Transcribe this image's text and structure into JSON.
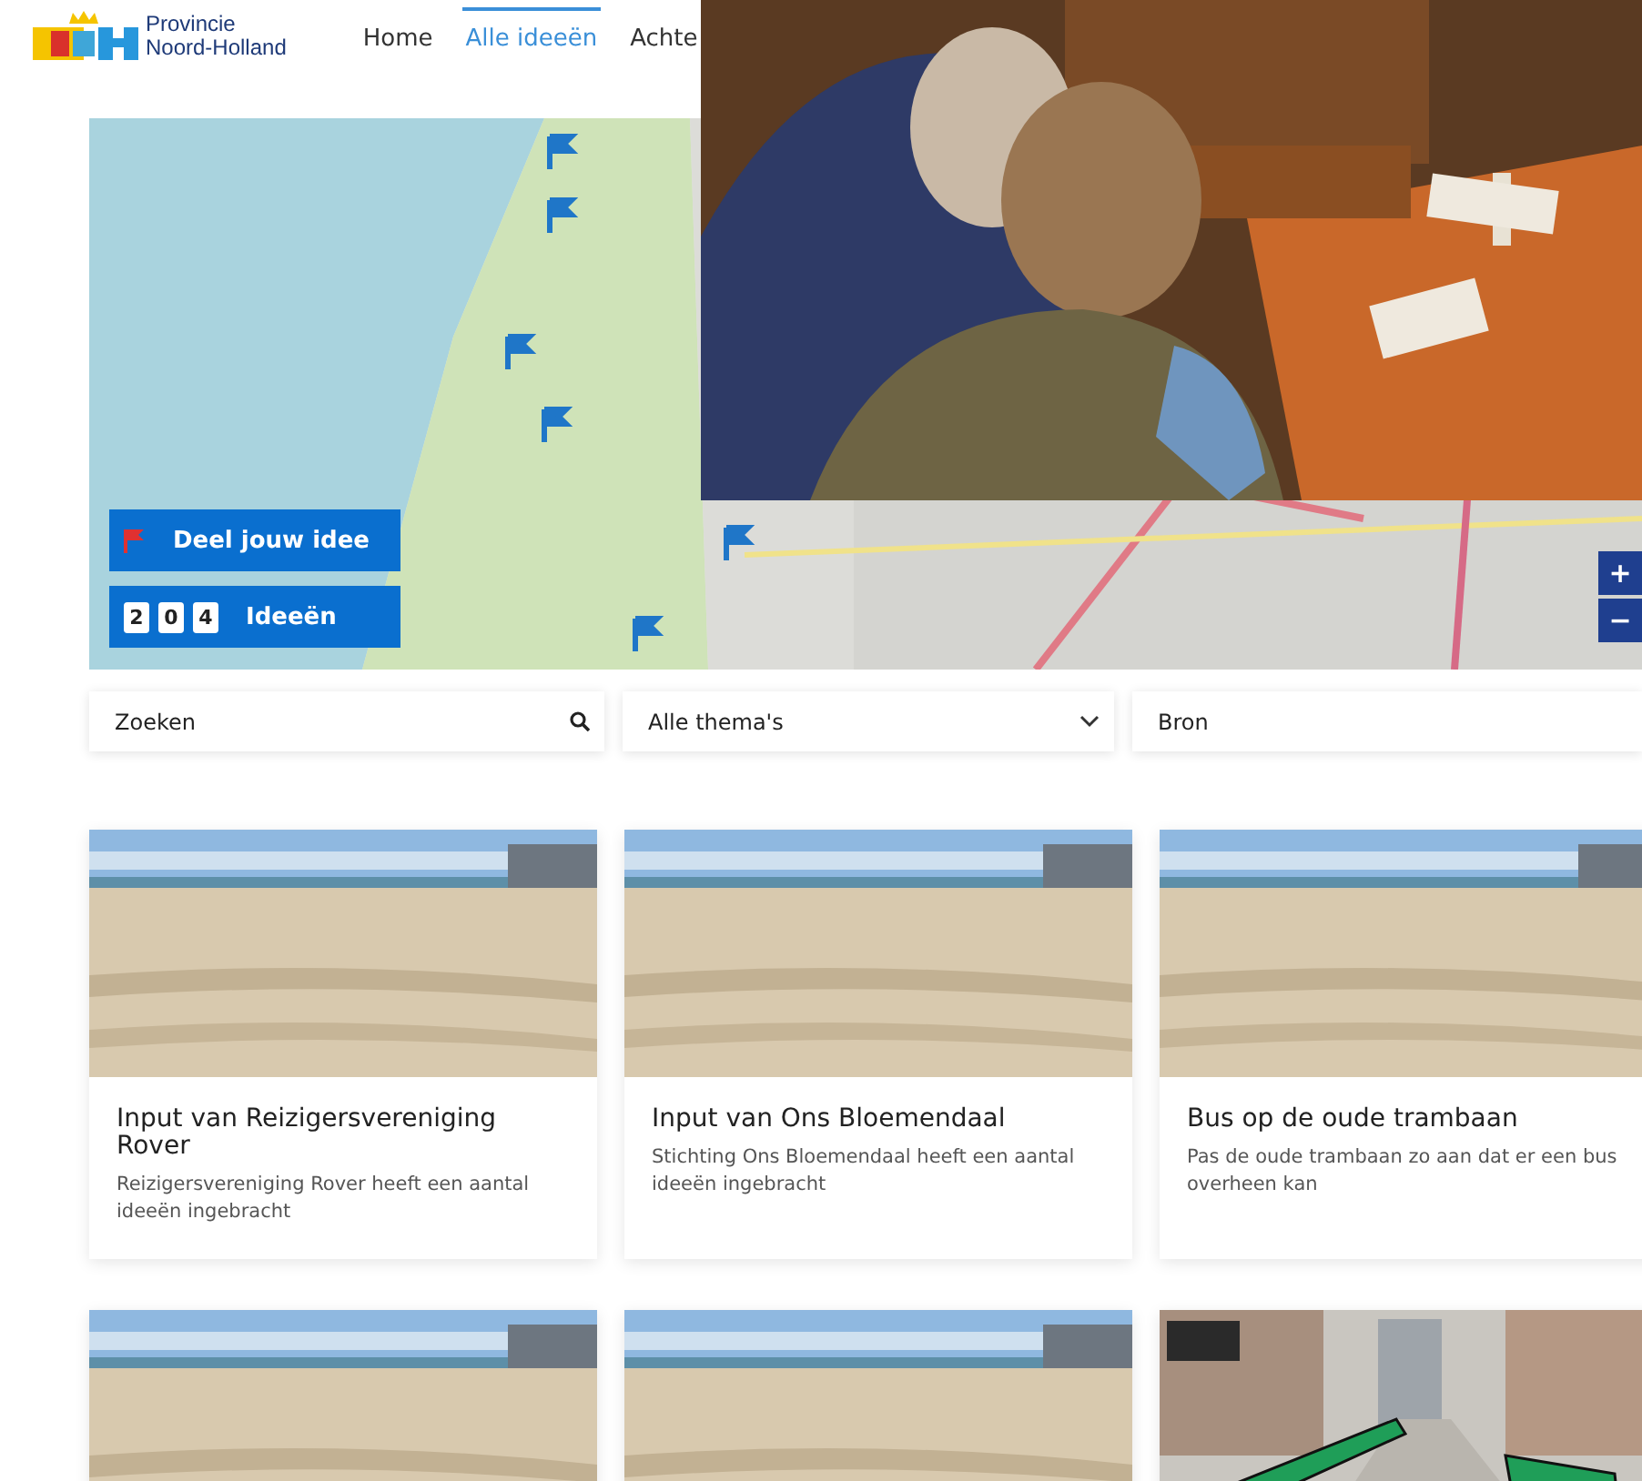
{
  "header": {
    "logo": {
      "line1": "Provincie",
      "line2": "Noord-Holland"
    },
    "nav": [
      {
        "label": "Home",
        "selected": false
      },
      {
        "label": "Alle ideeën",
        "selected": true
      },
      {
        "label": "Achte",
        "selected": false
      }
    ]
  },
  "map": {
    "share_button": "Deel jouw idee",
    "count_digits": [
      "2",
      "0",
      "4"
    ],
    "count_label": "Ideeën",
    "zoom_in": "+",
    "zoom_out": "−"
  },
  "filters": {
    "search": {
      "placeholder": "Zoeken"
    },
    "theme": "Alle thema's",
    "source": "Bron"
  },
  "cards": [
    {
      "kind": "card",
      "title": "Input van Reizigersvereniging Rover",
      "text": "Reizigersvereniging Rover heeft een aantal ideeën ingebracht"
    },
    {
      "kind": "card",
      "title": "Input van Ons Bloemendaal",
      "text": "Stichting Ons Bloemendaal heeft een aantal ideeën ingebracht"
    },
    {
      "kind": "card",
      "title": "Bus op de oude trambaan",
      "text": "Pas de oude trambaan zo aan dat er een bus overheen kan"
    },
    {
      "kind": "picture"
    },
    {
      "kind": "picture"
    },
    {
      "kind": "picture"
    }
  ]
}
